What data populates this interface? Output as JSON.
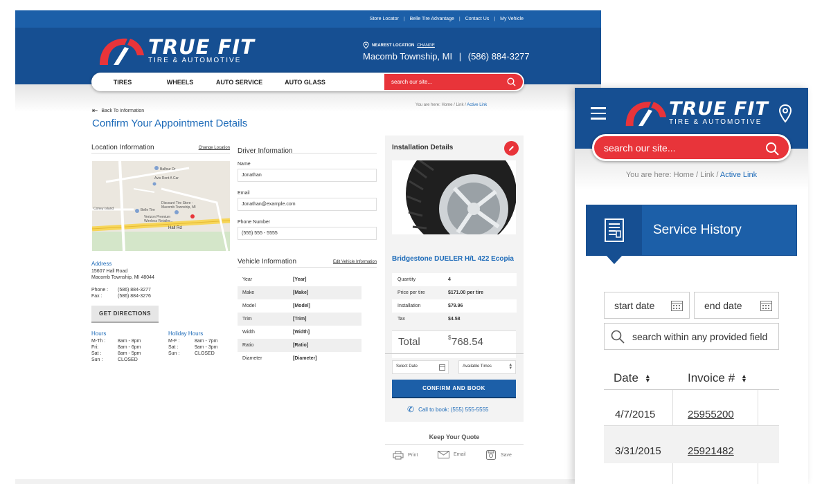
{
  "desktop": {
    "top_links": [
      "Store Locator",
      "Belle Tire Advantage",
      "Contact Us",
      "My Vehicle"
    ],
    "logo": {
      "name": "TRUE FIT",
      "sub": "TIRE & AUTOMOTIVE"
    },
    "location": {
      "label": "NEAREST LOCATION",
      "change": "CHANGE",
      "city": "Macomb Township, MI",
      "phone": "(586) 884-3277"
    },
    "nav": {
      "items": [
        "TIRES",
        "WHEELS",
        "AUTO SERVICE",
        "AUTO GLASS"
      ],
      "search_placeholder": "search our site..."
    },
    "back_link": "Back To Information",
    "breadcrumb": {
      "prefix": "You are here:",
      "home": "Home",
      "link": "Link",
      "active": "Active Link"
    },
    "page_title": "Confirm Your Appointment Details",
    "location_info": {
      "title": "Location Information",
      "change": "Change Location",
      "map": {
        "labels": [
          "Balfour Dr",
          "Avis Rent A Car",
          "Coney Island",
          "Belle Tire",
          "Discount Tire Store - Macomb Township, MI",
          "Verizon Premium Wireless Retailer...",
          "Hall Rd"
        ]
      },
      "address_title": "Address",
      "address_line1": "15607 Hall Road",
      "address_line2": "Macomb Township, MI 48044",
      "phone_label": "Phone :",
      "phone": "(586) 884-3277",
      "fax_label": "Fax :",
      "fax": "(586) 884-3276",
      "directions_button": "GET DIRECTIONS",
      "hours_title": "Hours",
      "hours": [
        [
          "M-Th :",
          "8am - 8pm"
        ],
        [
          "Fri:",
          "8am - 6pm"
        ],
        [
          "Sat :",
          "8am - 5pm"
        ],
        [
          "Sun :",
          "CLOSED"
        ]
      ],
      "holiday_title": "Holiday Hours",
      "holiday": [
        [
          "M-F :",
          "8am - 7pm"
        ],
        [
          "Sat :",
          "9am - 3pm"
        ],
        [
          "Sun :",
          "CLOSED"
        ]
      ]
    },
    "driver_info": {
      "title": "Driver Information",
      "name_label": "Name",
      "name": "Jonathan",
      "email_label": "Email",
      "email": "Jonathan@example.com",
      "phone_label": "Phone Number",
      "phone": "(555) 555 - 5555"
    },
    "vehicle_info": {
      "title": "Vehicle Information",
      "edit": "Edit Vehicle Information",
      "rows": [
        [
          "Year",
          "[Year]"
        ],
        [
          "Make",
          "[Make]"
        ],
        [
          "Model",
          "[Model]"
        ],
        [
          "Trim",
          "[Trim]"
        ],
        [
          "Width",
          "[Width]"
        ],
        [
          "Ratio",
          "[Ratio]"
        ],
        [
          "Diameter",
          "[Diameter]"
        ]
      ]
    },
    "installation": {
      "title": "Installation Details",
      "product": "Bridgestone DUELER H/L 422 Ecopia",
      "rows": [
        [
          "Quantity",
          "4"
        ],
        [
          "Price per tire",
          "$171.00 per tire"
        ],
        [
          "Installation",
          "$79.96"
        ],
        [
          "Tax",
          "$4.58"
        ]
      ],
      "total_label": "Total",
      "total_symbol": "$",
      "total_value": "768.54",
      "date_placeholder": "Select Date",
      "times_placeholder": "Available Times",
      "confirm_button": "CONFIRM AND BOOK",
      "call": "Call to book: (555) 555-5555",
      "keep_quote": "Keep Your Quote",
      "actions": [
        "Print",
        "Email",
        "Save"
      ]
    }
  },
  "mobile": {
    "logo": {
      "name": "TRUE FIT",
      "sub": "TIRE & AUTOMOTIVE"
    },
    "search_placeholder": "search our site...",
    "breadcrumb": {
      "prefix": "You are here:",
      "home": "Home",
      "link": "Link",
      "active": "Active Link"
    },
    "service_title": "Service History",
    "start_date": "start date",
    "end_date": "end date",
    "search_field": "search within any provided field",
    "columns": [
      "Date",
      "Invoice #"
    ],
    "rows": [
      [
        "4/7/2015",
        "25955200"
      ],
      [
        "3/31/2015",
        "25921482"
      ]
    ]
  },
  "colors": {
    "brand_blue": "#164f92",
    "accent_red": "#e8343a",
    "link_blue": "#1c6ab8"
  }
}
